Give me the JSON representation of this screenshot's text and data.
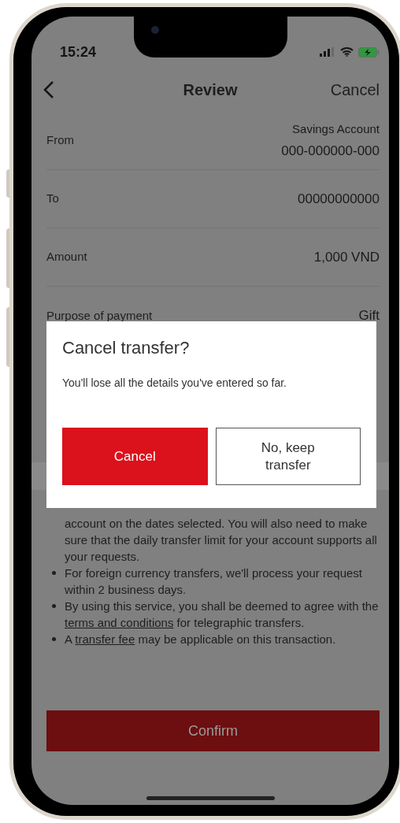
{
  "status_bar": {
    "time": "15:24"
  },
  "nav": {
    "title": "Review",
    "action": "Cancel"
  },
  "details": [
    {
      "label": "From",
      "values": [
        "Savings Account",
        "000-000000-000"
      ]
    },
    {
      "label": "To",
      "values": [
        "00000000000"
      ]
    },
    {
      "label": "Amount",
      "values": [
        "1,000 VND"
      ]
    },
    {
      "label": "Purpose of payment",
      "values": [
        "Gift"
      ]
    }
  ],
  "notes": [
    {
      "kind": "continued",
      "segments": [
        {
          "kind": "text",
          "text": "account on the dates selected. You will also need to make sure that the daily transfer limit for your account supports all your requests."
        }
      ]
    },
    {
      "kind": "bullet",
      "segments": [
        {
          "kind": "text",
          "text": "For foreign currency transfers, we'll process your request within 2 business days."
        }
      ]
    },
    {
      "kind": "bullet",
      "segments": [
        {
          "kind": "text",
          "text": "By using this service, you shall be deemed to agree with the "
        },
        {
          "kind": "link",
          "text": "terms and conditions"
        },
        {
          "kind": "text",
          "text": " for telegraphic transfers."
        }
      ]
    },
    {
      "kind": "bullet",
      "segments": [
        {
          "kind": "text",
          "text": "A "
        },
        {
          "kind": "link",
          "text": "transfer fee"
        },
        {
          "kind": "text",
          "text": " may be applicable on this transaction."
        }
      ]
    }
  ],
  "confirm_button": "Confirm",
  "dialog": {
    "title": "Cancel transfer?",
    "message": "You'll lose all the details you've entered so far.",
    "buttons": [
      {
        "kind": "primary",
        "label": "Cancel"
      },
      {
        "kind": "secondary",
        "label": "No, keep transfer"
      }
    ]
  }
}
